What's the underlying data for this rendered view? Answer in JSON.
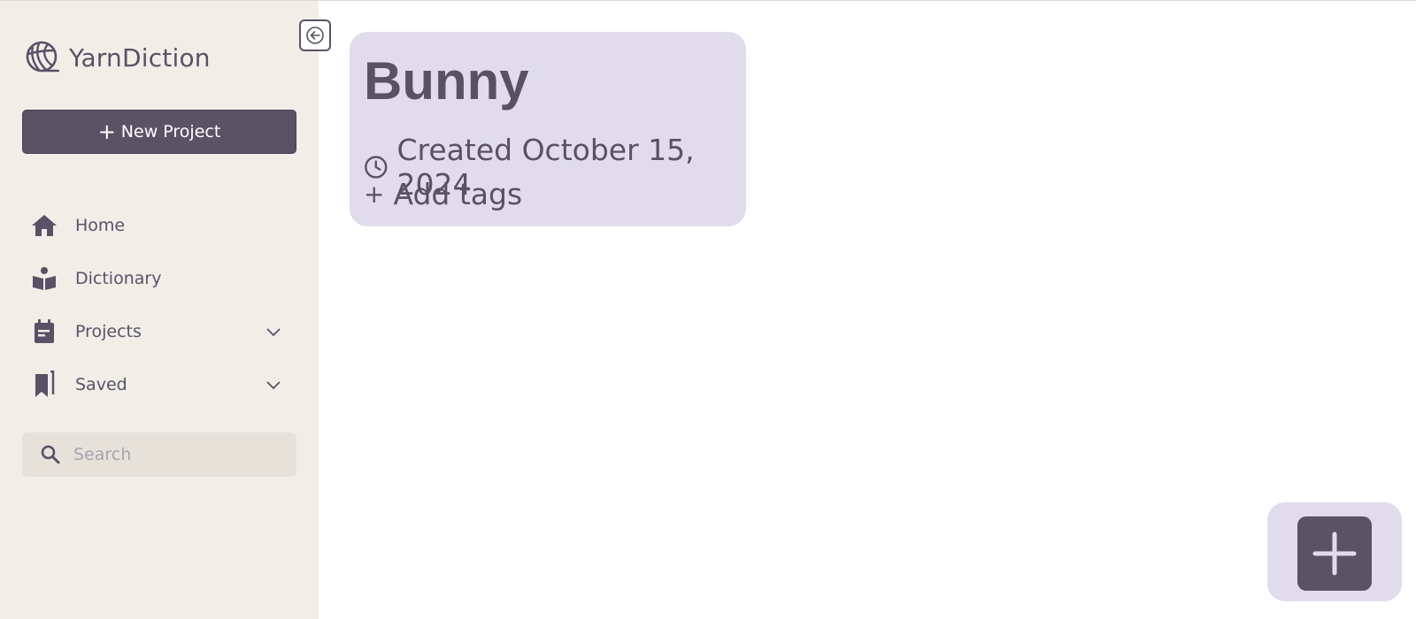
{
  "brand": {
    "name": "YarnDiction",
    "logo_icon": "yarn-ball-icon"
  },
  "sidebar": {
    "new_project_label": "New Project",
    "items": [
      {
        "label": "Home",
        "icon": "home-icon",
        "has_chevron": false
      },
      {
        "label": "Dictionary",
        "icon": "book-reader-icon",
        "has_chevron": false
      },
      {
        "label": "Projects",
        "icon": "calendar-icon",
        "has_chevron": true
      },
      {
        "label": "Saved",
        "icon": "bookmarks-icon",
        "has_chevron": true
      }
    ],
    "search": {
      "placeholder": "Search",
      "value": ""
    },
    "collapse_icon": "arrow-left-icon"
  },
  "project_card": {
    "title": "Bunny",
    "created": "Created October 15, 2024",
    "add_tags": "Add tags"
  },
  "fab": {
    "icon": "plus-icon"
  },
  "colors": {
    "sidebar_bg": "#f1eee8",
    "accent": "#5a5366",
    "card_bg": "#e0dcec",
    "text": "#5a5166"
  }
}
